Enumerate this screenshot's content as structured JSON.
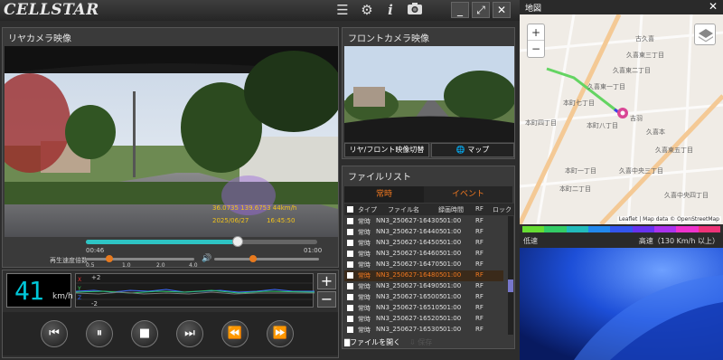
{
  "app": {
    "logo": "CELLSTAR"
  },
  "window": {
    "minimize": "_",
    "restore": "⤢",
    "close": "✕"
  },
  "rear": {
    "title": "リヤカメラ映像",
    "overlay_coords": "36.0735    139.6753    44km/h",
    "overlay_date": "2025/06/27",
    "overlay_time": "16:45:50",
    "time_current": "00:46",
    "time_total": "01:00",
    "progress": 0.65,
    "speed_label": "再生速度倍数",
    "speed_ticks": [
      "0.5",
      "1.0",
      "2.0",
      "4.0"
    ],
    "speed_value": 0.2,
    "volume_value": 0.35
  },
  "speed_display": {
    "value": "41",
    "unit": "km/h"
  },
  "gsensor": {
    "top": "+2",
    "bottom": "-2",
    "plus": "+",
    "minus": "−",
    "xyz": [
      "X",
      "Y",
      "Z"
    ]
  },
  "front": {
    "title": "フロントカメラ映像",
    "switch_label": "リヤ/フロント映像切替",
    "map_label": "マップ"
  },
  "filelist": {
    "title": "ファイルリスト",
    "tab_normal": "常時",
    "tab_event": "イベント",
    "columns": [
      "タイプ",
      "ファイル名",
      "録画時間",
      "RF",
      "ロック"
    ],
    "rows": [
      {
        "type": "常時",
        "name": "NN3_250627-164305",
        "dur": "01:00",
        "rf": "RF"
      },
      {
        "type": "常時",
        "name": "NN3_250627-164405",
        "dur": "01:00",
        "rf": "RF"
      },
      {
        "type": "常時",
        "name": "NN3_250627-164505",
        "dur": "01:00",
        "rf": "RF"
      },
      {
        "type": "常時",
        "name": "NN3_250627-164605",
        "dur": "01:00",
        "rf": "RF"
      },
      {
        "type": "常時",
        "name": "NN3_250627-164705",
        "dur": "01:00",
        "rf": "RF"
      },
      {
        "type": "常時",
        "name": "NN3_250627-164805",
        "dur": "01:00",
        "rf": "RF",
        "active": true
      },
      {
        "type": "常時",
        "name": "NN3_250627-164905",
        "dur": "01:00",
        "rf": "RF"
      },
      {
        "type": "常時",
        "name": "NN3_250627-165005",
        "dur": "01:00",
        "rf": "RF"
      },
      {
        "type": "常時",
        "name": "NN3_250627-165105",
        "dur": "01:00",
        "rf": "RF"
      },
      {
        "type": "常時",
        "name": "NN3_250627-165205",
        "dur": "01:00",
        "rf": "RF"
      },
      {
        "type": "常時",
        "name": "NN3_250627-165305",
        "dur": "01:00",
        "rf": "RF"
      }
    ],
    "open_label": "ファイルを開く",
    "save_label": "保存"
  },
  "map": {
    "title": "地図",
    "close": "✕",
    "zoom_in": "+",
    "zoom_out": "−",
    "attribution": "Leaflet | Map data © OpenStreetMap",
    "legend_low": "低速",
    "legend_high": "高速（130 Km/h 以上）",
    "labels": [
      "久喜東二丁目",
      "久喜東一丁目",
      "本町七丁目",
      "本町八丁目",
      "本町四丁目",
      "本町一丁目",
      "本町二丁目",
      "久喜中央三丁目",
      "久喜中央四丁目",
      "久喜本",
      "久喜東五丁目",
      "久喜東三丁目",
      "古久喜",
      "吉羽"
    ],
    "legend_colors": [
      "#66dd33",
      "#33cc66",
      "#22bbbb",
      "#2288ee",
      "#3355ee",
      "#6633ee",
      "#aa33ee",
      "#ee33cc",
      "#ee3377"
    ]
  }
}
